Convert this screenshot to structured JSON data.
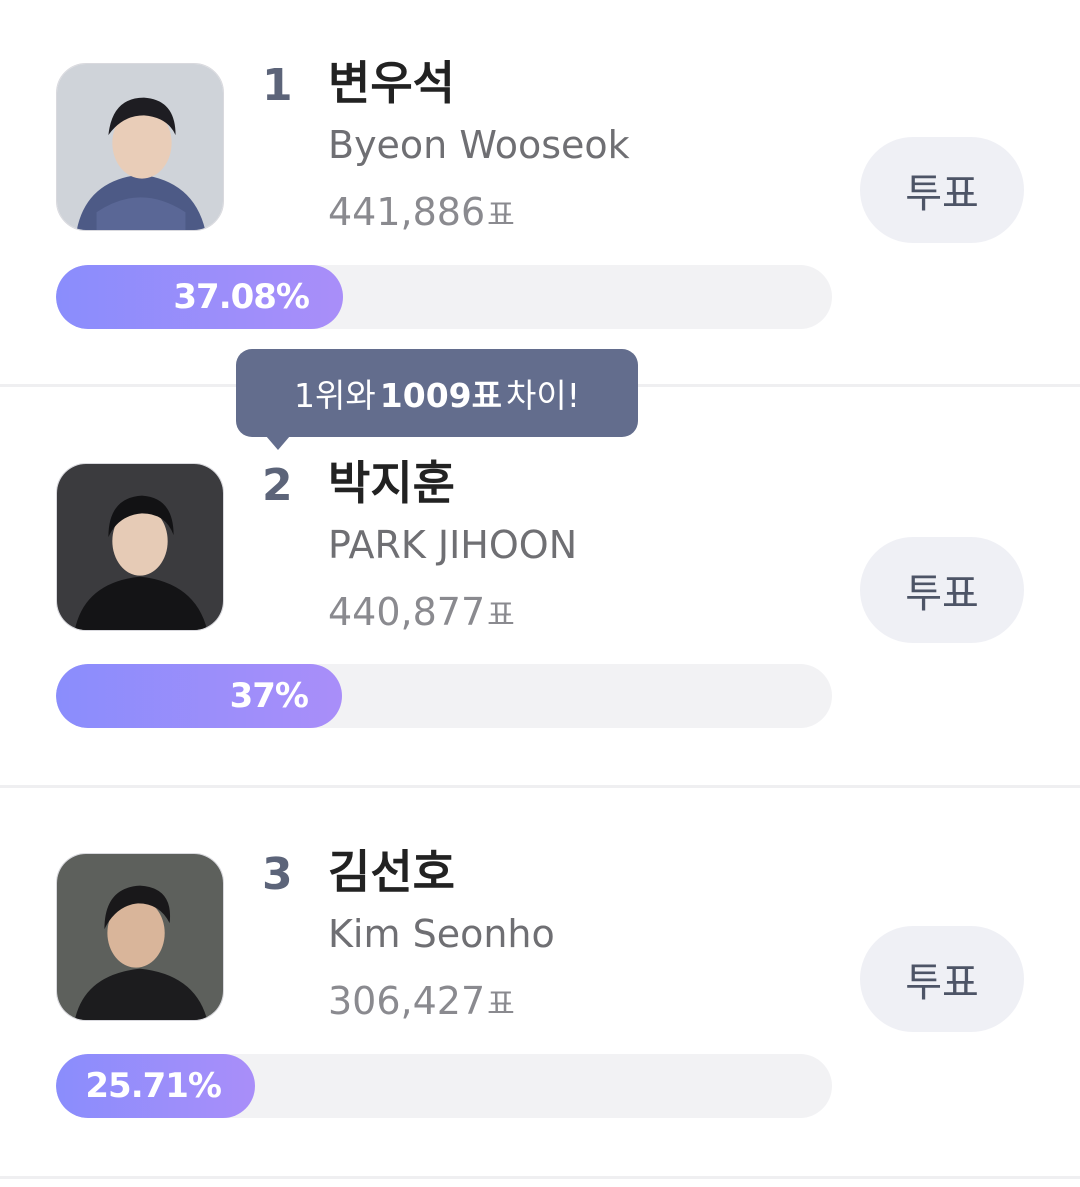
{
  "candidates": [
    {
      "rank": "1",
      "name": "변우석",
      "english_name": "Byeon Wooseok",
      "votes": "441,886",
      "percent_label": "37.08%",
      "percent": 37.08
    },
    {
      "rank": "2",
      "name": "박지훈",
      "english_name": "PARK JIHOON",
      "votes": "440,877",
      "percent_label": "37%",
      "percent": 37
    },
    {
      "rank": "3",
      "name": "김선호",
      "english_name": "Kim Seonho",
      "votes": "306,427",
      "percent_label": "25.71%",
      "percent": 25.71
    }
  ],
  "vote_unit": "표",
  "vote_button_label": "투표",
  "gap_tooltip": {
    "prefix": "1위와",
    "amount": "1009표",
    "suffix": "차이!"
  },
  "colors": {
    "bar_gradient_start": "#8a8dfc",
    "bar_gradient_end": "#a98ef9",
    "bar_track": "#f2f2f4",
    "tooltip_bg": "#636d8d",
    "button_bg": "#eff0f5"
  }
}
